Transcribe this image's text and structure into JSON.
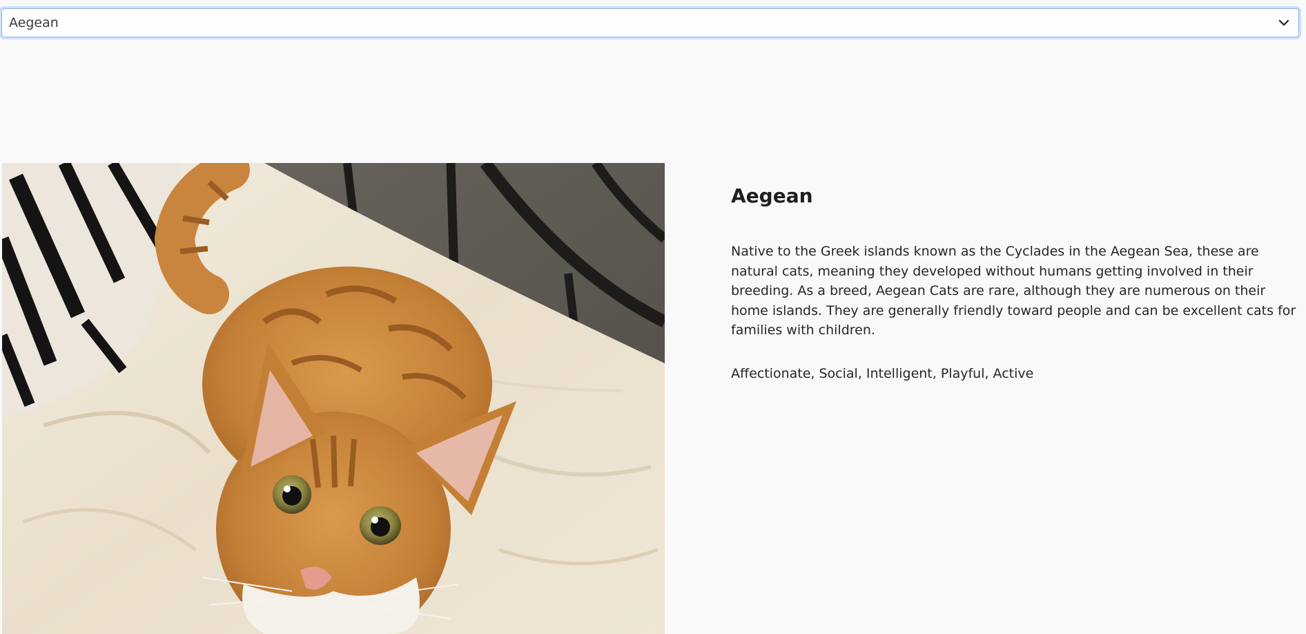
{
  "breed_select": {
    "selected": "Aegean",
    "icon": "chevron-down-icon"
  },
  "breed": {
    "name": "Aegean",
    "description": "Native to the Greek islands known as the Cyclades in the Aegean Sea, these are natural cats, meaning they developed without humans getting involved in their breeding. As a breed, Aegean Cats are rare, although they are numerous on their home islands. They are generally friendly toward people and can be excellent cats for families with children.",
    "temperament": "Affectionate, Social, Intelligent, Playful, Active"
  },
  "colors": {
    "background": "#f9f9f9",
    "select_border": "#8fb3e9"
  }
}
